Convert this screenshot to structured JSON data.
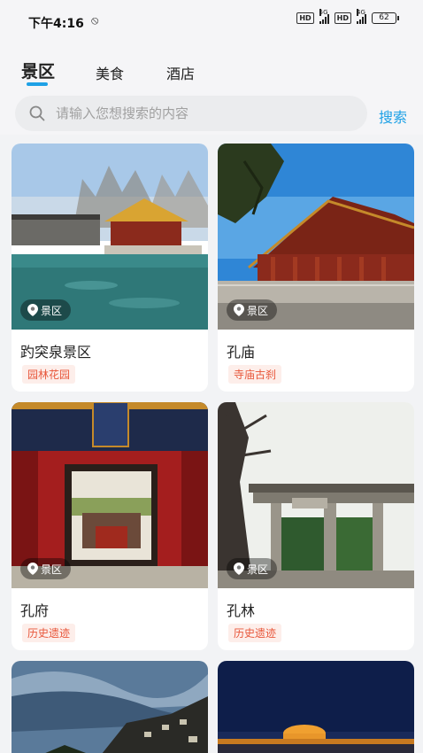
{
  "status_bar": {
    "time": "下午4:16",
    "hd1": "HD",
    "net1": "5G",
    "hd2": "HD",
    "net2": "4G",
    "battery": "62"
  },
  "tabs": [
    {
      "label": "景区",
      "active": true
    },
    {
      "label": "美食",
      "active": false
    },
    {
      "label": "酒店",
      "active": false
    }
  ],
  "search": {
    "placeholder": "请输入您想搜索的内容",
    "button_label": "搜索"
  },
  "cards": [
    {
      "title": "趵突泉景区",
      "chip": "景区",
      "badge": "园林花园",
      "icon": "location-pin-icon"
    },
    {
      "title": "孔庙",
      "chip": "景区",
      "badge": "寺庙古刹",
      "icon": "location-pin-icon"
    },
    {
      "title": "孔府",
      "chip": "景区",
      "badge": "历史遗迹",
      "icon": "location-pin-icon"
    },
    {
      "title": "孔林",
      "chip": "景区",
      "badge": "历史遗迹",
      "icon": "location-pin-icon"
    }
  ],
  "colors": {
    "accent": "#1ea1e6",
    "badge_text": "#e8563a",
    "badge_bg": "#fdeeea"
  }
}
